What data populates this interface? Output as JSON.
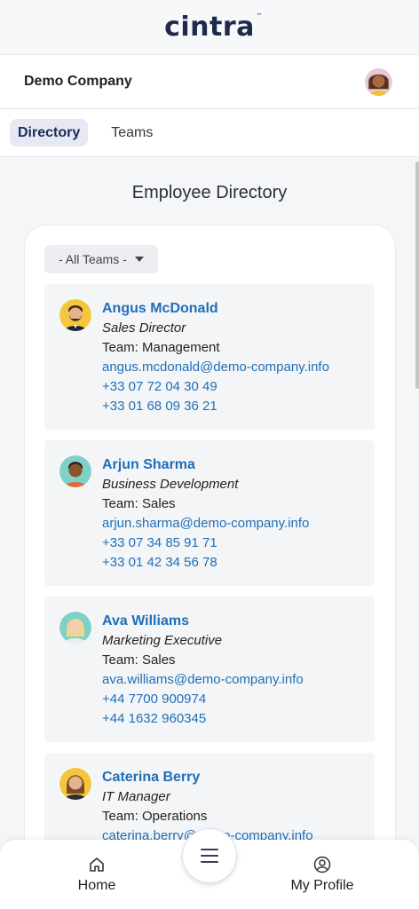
{
  "brand": {
    "name": "cintra",
    "tm": "™"
  },
  "company": {
    "name": "Demo Company"
  },
  "tabs": [
    {
      "label": "Directory",
      "active": true
    },
    {
      "label": "Teams",
      "active": false
    }
  ],
  "page": {
    "title": "Employee Directory"
  },
  "filter": {
    "label": "- All Teams -"
  },
  "employees": [
    {
      "name": "Angus McDonald",
      "title": "Sales Director",
      "team": "Team: Management",
      "email": "angus.mcdonald@demo-company.info",
      "phone1": "+33 07 72 04 30 49",
      "phone2": "+33 01 68 09 36 21"
    },
    {
      "name": "Arjun Sharma",
      "title": "Business Development",
      "team": "Team: Sales",
      "email": "arjun.sharma@demo-company.info",
      "phone1": "+33 07 34 85 91 71",
      "phone2": "+33 01 42 34 56 78"
    },
    {
      "name": "Ava Williams",
      "title": "Marketing Executive",
      "team": "Team: Sales",
      "email": "ava.williams@demo-company.info",
      "phone1": "+44 7700 900974",
      "phone2": "+44 1632 960345"
    },
    {
      "name": "Caterina Berry",
      "title": "IT Manager",
      "team": "Team: Operations",
      "email": "caterina.berry@demo-company.info",
      "phone1": "",
      "phone2": ""
    }
  ],
  "nav": {
    "home": {
      "label": "Home",
      "icon": "home-icon"
    },
    "menu": {
      "icon": "menu-icon"
    },
    "profile": {
      "label": "My Profile",
      "icon": "user-circle-icon"
    }
  },
  "colors": {
    "accent": "#1f6fb8",
    "brand": "#1d2a4a"
  }
}
